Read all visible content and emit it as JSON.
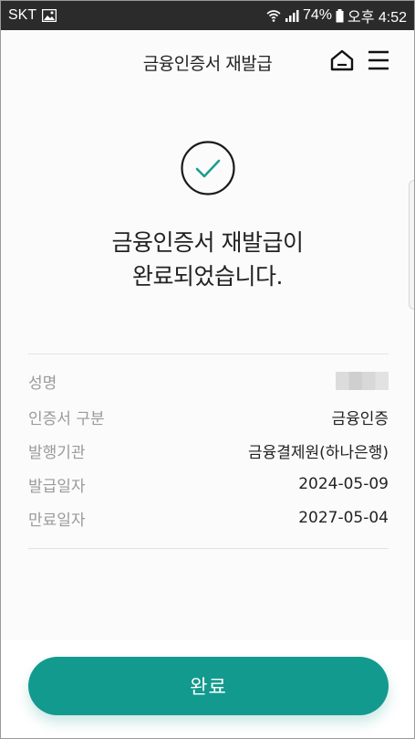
{
  "status_bar": {
    "carrier": "SKT",
    "battery": "74%",
    "time": "오후 4:52"
  },
  "header": {
    "title": "금융인증서 재발급",
    "home_icon": "home-icon",
    "menu_icon": "hamburger-menu-icon"
  },
  "result": {
    "icon": "check-circle-icon",
    "message_line1": "금융인증서 재발급이",
    "message_line2": "완료되었습니다."
  },
  "details": [
    {
      "label": "성명",
      "value": ""
    },
    {
      "label": "인증서 구분",
      "value": "금융인증"
    },
    {
      "label": "발행기관",
      "value": "금융결제원(하나은행)"
    },
    {
      "label": "발급일자",
      "value": "2024-05-09"
    },
    {
      "label": "만료일자",
      "value": "2027-05-04"
    }
  ],
  "colors": {
    "accent": "#139a8e",
    "check": "#1a9e8f",
    "label": "#9a9a9a"
  },
  "footer": {
    "done_label": "완료"
  }
}
